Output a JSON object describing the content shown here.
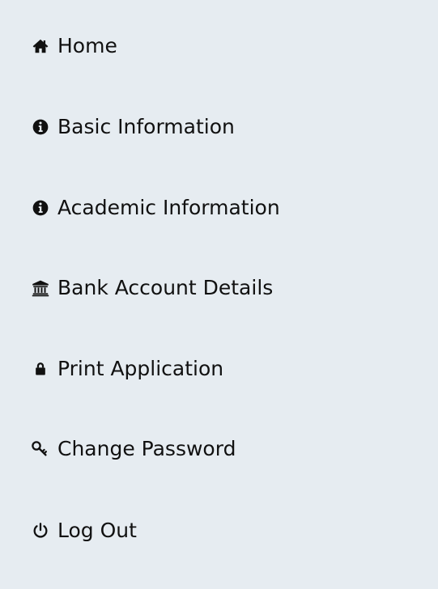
{
  "sidebar": {
    "items": [
      {
        "label": "Home",
        "icon": "home-icon"
      },
      {
        "label": "Basic Information",
        "icon": "info-circle-icon"
      },
      {
        "label": "Academic Information",
        "icon": "info-circle-icon"
      },
      {
        "label": "Bank Account Details",
        "icon": "bank-icon"
      },
      {
        "label": "Print Application",
        "icon": "lock-icon"
      },
      {
        "label": "Change Password",
        "icon": "key-icon"
      },
      {
        "label": "Log Out",
        "icon": "power-icon"
      }
    ]
  }
}
